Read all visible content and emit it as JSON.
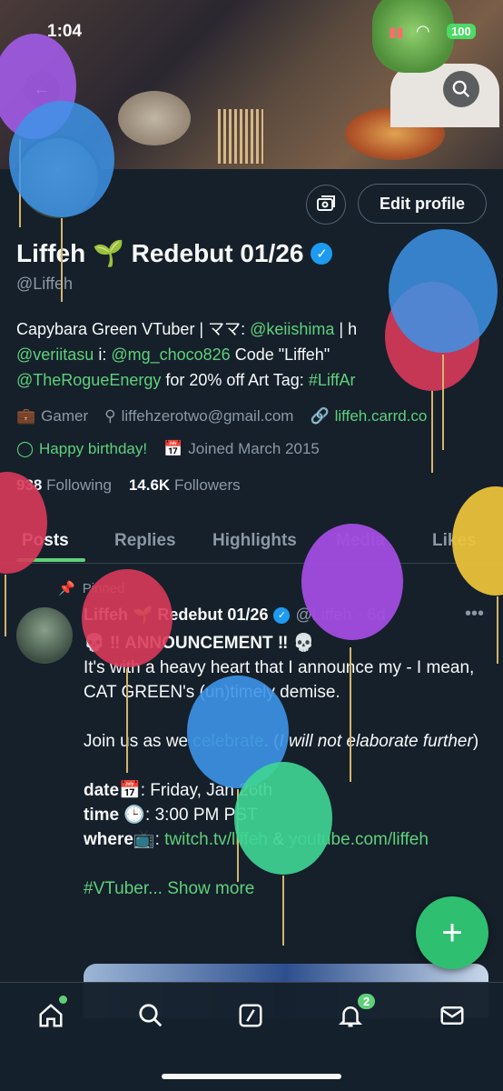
{
  "status": {
    "time": "1:04",
    "battery": "100"
  },
  "profile": {
    "edit_label": "Edit profile",
    "name": "Liffeh 🌱 Redebut 01/26",
    "handle": "@Liffeh",
    "bio": {
      "l1a": "Capybara Green VTuber | ママ: ",
      "l1b": "@keiishima",
      "l1c": " | h",
      "l2a": "@veriitasu",
      "l2b": " i: ",
      "l2c": "@mg_choco826",
      "l2d": " Code \"Liffeh\"",
      "l3a": "@TheRogueEnergy",
      "l3b": " for 20% off Art Tag: ",
      "l3c": "#LiffAr"
    },
    "category": "Gamer",
    "email": "liffehzerotwo@gmail.com",
    "website": "liffeh.carrd.co",
    "birthday": "Happy birthday!",
    "joined": "Joined March 2015",
    "following_count": "938",
    "following_label": "Following",
    "followers_count": "14.6K",
    "followers_label": "Followers"
  },
  "tabs": [
    "Posts",
    "Replies",
    "Highlights",
    "Media",
    "Likes"
  ],
  "post": {
    "pinned_label": "Pinned",
    "author_name": "Liffeh 🌱 Redebut 01/26",
    "author_handle": "@Liffeh",
    "age": "· 6d",
    "line1": "💀 ‼ ANNOUNCEMENT ‼ 💀",
    "line2": "It's with a heavy heart that I announce my - I mean, CAT GREEN's (un)timely demise.",
    "line3a": "Join us as we ",
    "line3b": "celebrate",
    "line3c": ". (",
    "line3d": "I will not elaborate further",
    "line3e": ")",
    "date_label": "date📅",
    "date_value": ": Friday, Jan 26th",
    "time_label": "time 🕒",
    "time_value": ": 3:00 PM PST",
    "where_label": "where📺",
    "where_sep": ": ",
    "where_link1": "twitch.tv/liffeh",
    "where_amp": " & ",
    "where_link2": "youtube.com/liffeh",
    "hashtag": "#VTuber",
    "show_more": "... Show more"
  },
  "nav": {
    "notif_badge": "2"
  },
  "colors": {
    "accent": "#5fd07a",
    "background": "#15202b",
    "verified": "#1d9bf0"
  }
}
